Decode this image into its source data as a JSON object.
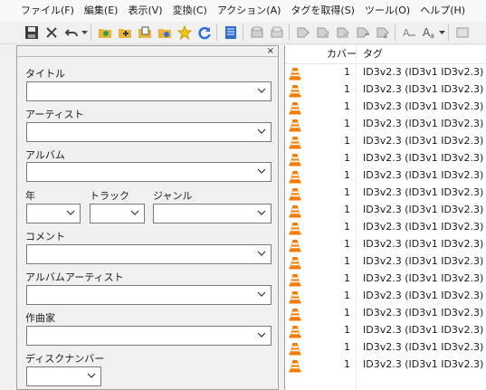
{
  "menu": [
    "ファイル(F)",
    "編集(E)",
    "表示(V)",
    "変換(C)",
    "アクション(A)",
    "タグを取得(S)",
    "ツール(O)",
    "ヘルプ(H)"
  ],
  "toolbar": {
    "icons": [
      "save-icon",
      "delete-icon",
      "undo-icon",
      "undo-dropdown-icon",
      "open-folder-icon",
      "add-folder-icon",
      "playlist-icon",
      "folder-settings-icon",
      "favorite-icon",
      "refresh-icon",
      "select-all-icon",
      "tag-to-filename-icon",
      "filename-to-tag-icon",
      "tag-source-icon",
      "text-file-icon",
      "export-icon",
      "case-convert-icon",
      "font-icon",
      "font-dropdown-icon",
      "more-icon"
    ]
  },
  "tag_panel": {
    "close": "×",
    "labels": {
      "title": "タイトル",
      "artist": "アーティスト",
      "album": "アルバム",
      "year": "年",
      "track": "トラック",
      "genre": "ジャンル",
      "comment": "コメント",
      "album_artist": "アルバムアーティスト",
      "composer": "作曲家",
      "disc_number": "ディスクナンバー"
    },
    "values": {
      "title": "",
      "artist": "",
      "album": "",
      "year": "",
      "track": "",
      "genre": "",
      "comment": "",
      "album_artist": "",
      "composer": "",
      "disc_number": ""
    }
  },
  "file_list": {
    "columns": [
      "カバー",
      "タグ"
    ],
    "rows": [
      {
        "cover": "1",
        "tag": "ID3v2.3 (ID3v1 ID3v2.3)"
      },
      {
        "cover": "1",
        "tag": "ID3v2.3 (ID3v1 ID3v2.3)"
      },
      {
        "cover": "1",
        "tag": "ID3v2.3 (ID3v1 ID3v2.3)"
      },
      {
        "cover": "1",
        "tag": "ID3v2.3 (ID3v1 ID3v2.3)"
      },
      {
        "cover": "1",
        "tag": "ID3v2.3 (ID3v1 ID3v2.3)"
      },
      {
        "cover": "1",
        "tag": "ID3v2.3 (ID3v1 ID3v2.3)"
      },
      {
        "cover": "1",
        "tag": "ID3v2.3 (ID3v1 ID3v2.3)"
      },
      {
        "cover": "1",
        "tag": "ID3v2.3 (ID3v1 ID3v2.3)"
      },
      {
        "cover": "1",
        "tag": "ID3v2.3 (ID3v1 ID3v2.3)"
      },
      {
        "cover": "1",
        "tag": "ID3v2.3 (ID3v1 ID3v2.3)"
      },
      {
        "cover": "1",
        "tag": "ID3v2.3 (ID3v1 ID3v2.3)"
      },
      {
        "cover": "1",
        "tag": "ID3v2.3 (ID3v1 ID3v2.3)"
      },
      {
        "cover": "1",
        "tag": "ID3v2.3 (ID3v1 ID3v2.3)"
      },
      {
        "cover": "1",
        "tag": "ID3v2.3 (ID3v1 ID3v2.3)"
      },
      {
        "cover": "1",
        "tag": "ID3v2.3 (ID3v1 ID3v2.3)"
      },
      {
        "cover": "1",
        "tag": "ID3v2.3 (ID3v1 ID3v2.3)"
      },
      {
        "cover": "1",
        "tag": "ID3v2.3 (ID3v1 ID3v2.3)"
      },
      {
        "cover": "1",
        "tag": "ID3v2.3 (ID3v1 ID3v2.3)"
      }
    ],
    "row_icon": "vlc-cone-icon"
  },
  "colors": {
    "accent_cone": "#f57c00",
    "border": "#7a7a7a",
    "background": "#f0f0f0"
  }
}
